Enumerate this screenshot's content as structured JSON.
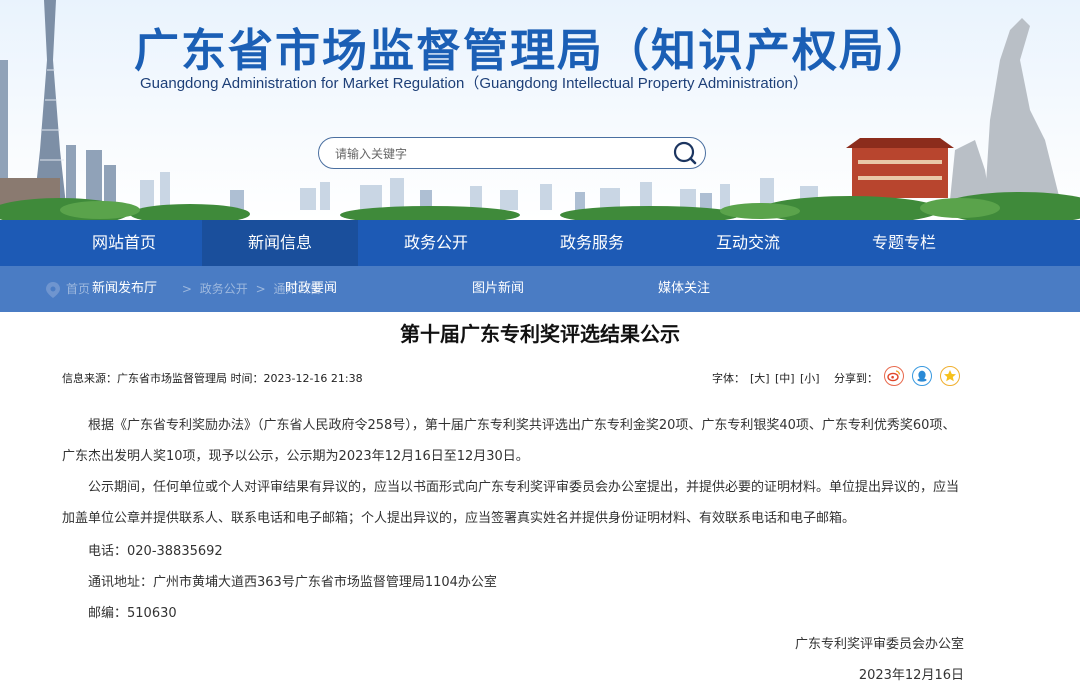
{
  "header": {
    "title": "广东省市场监督管理局（知识产权局）",
    "subtitle": "Guangdong Administration for Market Regulation（Guangdong Intellectual Property Administration）",
    "search_placeholder": "请输入关键字"
  },
  "nav": {
    "items": [
      "网站首页",
      "新闻信息",
      "政务公开",
      "政务服务",
      "互动交流",
      "专题专栏"
    ],
    "active_index": 1
  },
  "subnav": {
    "breadcrumb": [
      "首页",
      "政务公开",
      "通知公告"
    ],
    "items": [
      "新闻发布厅",
      "时政要闻",
      "图片新闻",
      "媒体关注"
    ]
  },
  "article": {
    "title": "第十届广东专利奖评选结果公示",
    "meta": "信息来源：广东省市场监督管理局  时间：2023-12-16 21:38",
    "font_label": "字体：",
    "font_sizes": [
      "[大]",
      "[中]",
      "[小]"
    ],
    "share_label": "分享到：",
    "share_icons": [
      "weibo-icon",
      "qq-icon",
      "qzone-icon"
    ],
    "paragraphs": [
      "根据《广东省专利奖励办法》（广东省人民政府令258号），第十届广东专利奖共评选出广东专利金奖20项、广东专利银奖40项、广东专利优秀奖60项、广东杰出发明人奖10项，现予以公示，公示期为2023年12月16日至12月30日。",
      "公示期间，任何单位或个人对评审结果有异议的，应当以书面形式向广东专利奖评审委员会办公室提出，并提供必要的证明材料。单位提出异议的，应当加盖单位公章并提供联系人、联系电话和电子邮箱；个人提出异议的，应当签署真实姓名并提供身份证明材料、有效联系电话和电子邮箱。"
    ],
    "phone": "电话：020-38835692",
    "address": "通讯地址：广州市黄埔大道西363号广东省市场监督管理局1104办公室",
    "postcode": "邮编：510630",
    "signature": "广东专利奖评审委员会办公室",
    "date": "2023年12月16日"
  },
  "colors": {
    "title_blue": "#1b5fb5",
    "nav_blue": "#1d5ab5",
    "nav_active": "#1a4f9c",
    "subnav_blue": "#4a7cc4"
  }
}
